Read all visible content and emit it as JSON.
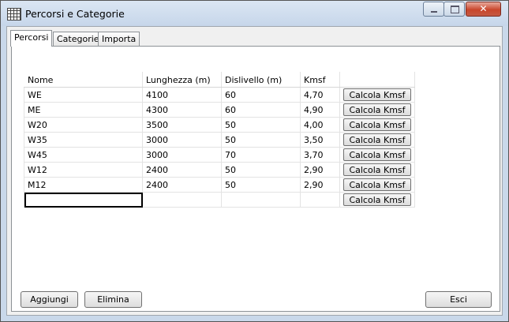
{
  "window": {
    "title": "Percorsi e Categorie",
    "close_glyph": "✕"
  },
  "tabs": [
    {
      "label": "Percorsi",
      "active": true
    },
    {
      "label": "Categorie",
      "active": false
    },
    {
      "label": "Importa",
      "active": false
    }
  ],
  "grid": {
    "headers": [
      "Nome",
      "Lunghezza (m)",
      "Dislivello (m)",
      "Kmsf",
      ""
    ],
    "button_label": "Calcola Kmsf",
    "rows": [
      [
        "WE",
        "4100",
        "60",
        "4,70"
      ],
      [
        "ME",
        "4300",
        "60",
        "4,90"
      ],
      [
        "W20",
        "3500",
        "50",
        "4,00"
      ],
      [
        "W35",
        "3000",
        "50",
        "3,50"
      ],
      [
        "W45",
        "3000",
        "70",
        "3,70"
      ],
      [
        "W12",
        "2400",
        "50",
        "2,90"
      ],
      [
        "M12",
        "2400",
        "50",
        "2,90"
      ],
      [
        "",
        "",
        "",
        ""
      ]
    ]
  },
  "buttons": {
    "add": "Aggiungi",
    "delete": "Elimina",
    "exit": "Esci"
  },
  "colors": {
    "title_gradient": "#c6d6ea",
    "close": "#c9462c",
    "panel": "#f0f0f0"
  },
  "icons": {
    "app": "grid-icon",
    "minimize": "minimize-icon",
    "maximize": "maximize-icon",
    "close": "close-icon"
  }
}
